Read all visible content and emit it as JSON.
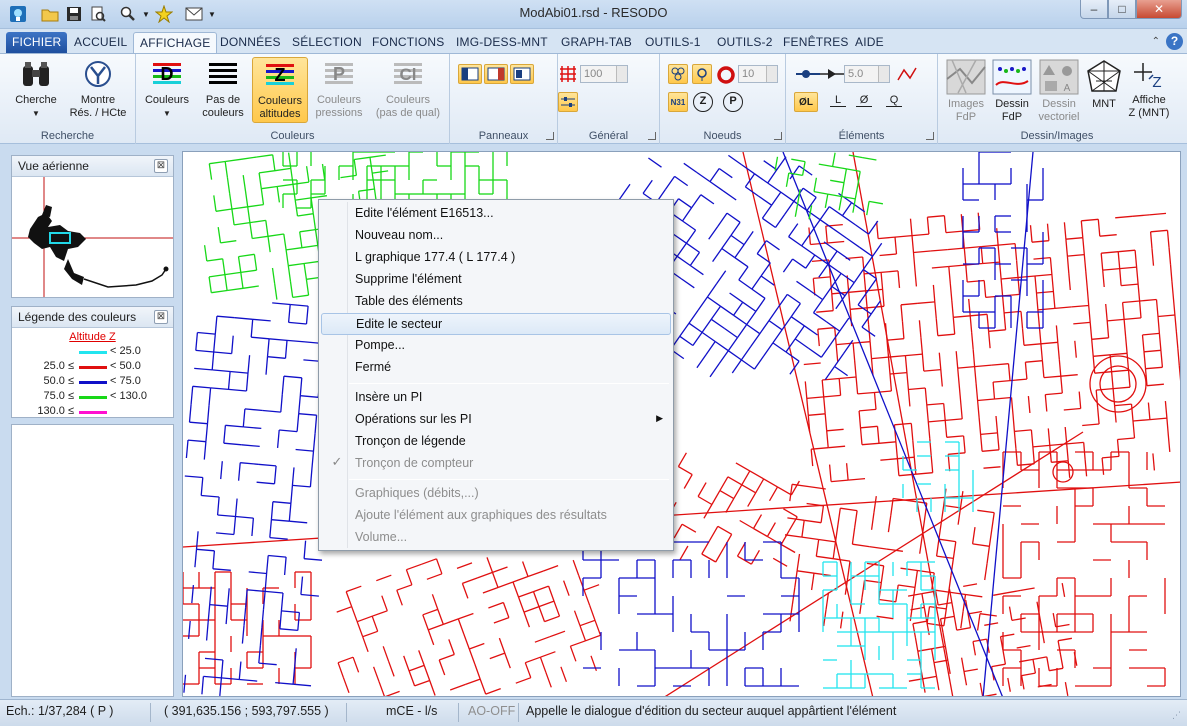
{
  "window": {
    "title": "ModAbi01.rsd - RESODO",
    "min_label": "‒",
    "max_label": "□",
    "close_label": "✕"
  },
  "qat": {
    "icons": [
      "app-icon",
      "open-folder-icon",
      "save-icon",
      "print-preview-icon",
      "zoom-icon",
      "wand-icon",
      "mail-icon"
    ]
  },
  "menu": {
    "tabs": [
      "FICHIER",
      "ACCUEIL",
      "AFFICHAGE",
      "DONNÉES",
      "SÉLECTION",
      "FONCTIONS",
      "IMG-DESS-MNT",
      "GRAPH-TAB",
      "OUTILS-1",
      "OUTILS-2",
      "FENÊTRES",
      "AIDE"
    ],
    "active": "AFFICHAGE",
    "help_label": "?"
  },
  "ribbon": {
    "recherche": {
      "label": "Recherche",
      "cherche": "Cherche",
      "montre_1": "Montre",
      "montre_2": "Rés. / HCte"
    },
    "couleurs": {
      "label": "Couleurs",
      "couleurs": "Couleurs",
      "pas_1": "Pas de",
      "pas_2": "couleurs",
      "alt_1": "Couleurs",
      "alt_2": "altitudes",
      "press_1": "Couleurs",
      "press_2": "pressions",
      "qual_1": "Couleurs",
      "qual_2": "(pas de qual)"
    },
    "panneaux": {
      "label": "Panneaux"
    },
    "general": {
      "label": "Général",
      "spin_value": "100"
    },
    "noeuds": {
      "label": "Noeuds",
      "spin_value": "10",
      "btn_n31": "N31",
      "btn_z": "Z",
      "btn_p": "P"
    },
    "elements": {
      "label": "Éléments",
      "spin_value": "5.0",
      "btn_l": "L",
      "btn_phi": "Ø",
      "btn_q": "Q",
      "btn_phil": "ØL"
    },
    "dessin": {
      "label": "Dessin/Images",
      "img_1": "Images",
      "img_2": "FdP",
      "dfdp_1": "Dessin",
      "dfdp_2": "FdP",
      "dvec_1": "Dessin",
      "dvec_2": "vectoriel",
      "mnt": "MNT",
      "affz_1": "Affiche",
      "affz_2": "Z (MNT)"
    }
  },
  "aerial": {
    "title": "Vue aérienne",
    "close": "⊠"
  },
  "legend": {
    "title": "Légende des couleurs",
    "close": "⊠",
    "subtitle": "Altitude Z",
    "rows": [
      {
        "lo": "",
        "hi": "< 25.0",
        "color": "#22e5ef"
      },
      {
        "lo": "25.0 ≤",
        "hi": "< 50.0",
        "color": "#e01010"
      },
      {
        "lo": "50.0 ≤",
        "hi": "< 75.0",
        "color": "#1010c8"
      },
      {
        "lo": "75.0 ≤",
        "hi": "< 130.0",
        "color": "#18d818"
      },
      {
        "lo": "130.0 ≤",
        "hi": "",
        "color": "#ff10d0"
      }
    ]
  },
  "context_menu": {
    "items": [
      {
        "label": "Edite l'élément E16513...",
        "state": "normal"
      },
      {
        "label": "Nouveau nom...",
        "state": "normal"
      },
      {
        "label": "L graphique 177.4  ( L 177.4 )",
        "state": "normal"
      },
      {
        "label": "Supprime l'élément",
        "state": "normal"
      },
      {
        "label": "Table des éléments",
        "state": "normal"
      },
      {
        "label": "Edite le secteur",
        "state": "hover"
      },
      {
        "label": "Pompe...",
        "state": "normal"
      },
      {
        "label": "Fermé",
        "state": "normal"
      },
      {
        "label": "Insère un PI",
        "state": "normal"
      },
      {
        "label": "Opérations sur les PI",
        "state": "submenu"
      },
      {
        "label": "Tronçon de légende",
        "state": "normal"
      },
      {
        "label": "Tronçon de compteur",
        "state": "disabled-checked"
      },
      {
        "label": "Graphiques (débits,...)",
        "state": "disabled"
      },
      {
        "label": "Ajoute l'élément aux graphiques des résultats",
        "state": "disabled"
      },
      {
        "label": "Volume...",
        "state": "disabled"
      }
    ]
  },
  "status": {
    "scale": "Ech.: 1/37,284   ( P )",
    "coords": "( 391,635.156 ; 593,797.555 )",
    "units": "mCE - l/s",
    "ao": "AO-OFF",
    "hint": "Appelle le dialogue d'édition du secteur auquel appârtient l'élément"
  },
  "map": {
    "colors": {
      "low": "#22e5ef",
      "mid_low": "#e01010",
      "mid": "#1010c8",
      "high": "#18d818"
    }
  }
}
